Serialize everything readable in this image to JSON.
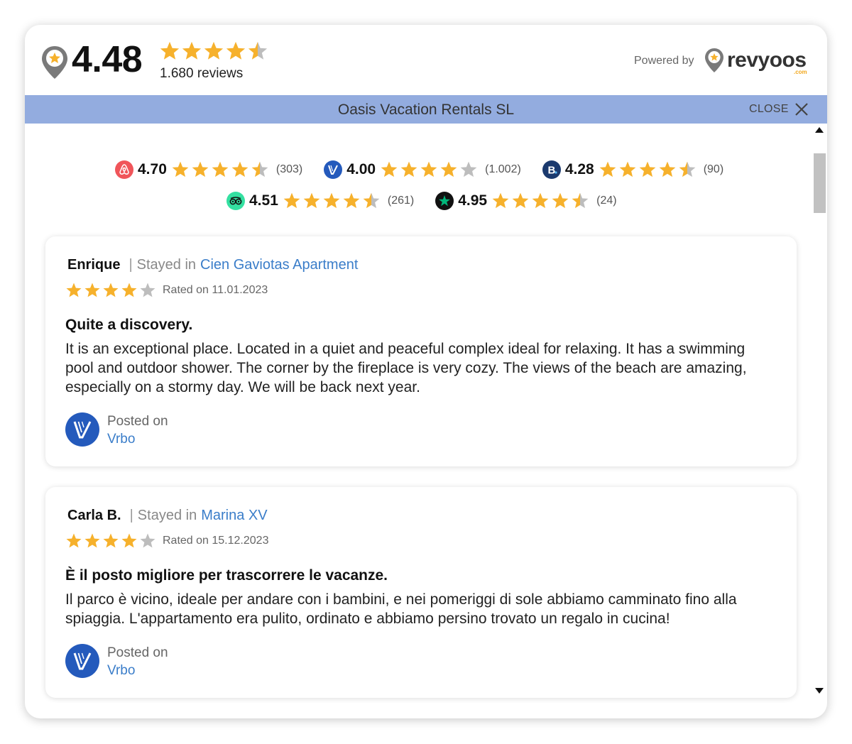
{
  "header": {
    "overall_rating": "4.48",
    "overall_stars": 4.48,
    "reviews_count": "1.680 reviews",
    "powered_by": "Powered by",
    "brand": "revyoos",
    "brand_suffix": ".com"
  },
  "titlebar": {
    "company": "Oasis Vacation Rentals SL",
    "close_label": "CLOSE"
  },
  "platforms": [
    {
      "icon": "airbnb-icon",
      "rating": "4.70",
      "count": "(303)",
      "color": "#f0555a"
    },
    {
      "icon": "vrbo-icon",
      "rating": "4.00",
      "count": "(1.002)",
      "color": "#245abc"
    },
    {
      "icon": "booking-icon",
      "rating": "4.28",
      "count": "(90)",
      "color": "#1b3a6e"
    },
    {
      "icon": "tripadvisor-icon",
      "rating": "4.51",
      "count": "(261)",
      "color": "#34e0a1"
    },
    {
      "icon": "trustpilot-icon",
      "rating": "4.95",
      "count": "(24)",
      "color": "#111111"
    }
  ],
  "reviews": [
    {
      "name": "Enrique",
      "stayed_prefix": "Stayed in",
      "property": "Cien Gaviotas Apartment",
      "stars": 4,
      "rated": "Rated on 11.01.2023",
      "title": "Quite a discovery.",
      "body": "It is an exceptional place. Located in a quiet and peaceful complex ideal for relaxing. It has a swimming pool and outdoor shower. The corner by the fireplace is very cozy. The views of the beach are amazing, especially on a stormy day. We will be back next year.",
      "posted_label": "Posted on",
      "platform": "Vrbo"
    },
    {
      "name": "Carla B.",
      "stayed_prefix": "Stayed in",
      "property": "Marina XV",
      "stars": 4,
      "rated": "Rated on 15.12.2023",
      "title": "È il posto migliore per trascorrere le vacanze.",
      "body": "Il parco è vicino, ideale per andare con i bambini, e nei pomeriggi di sole abbiamo camminato fino alla spiaggia. L'appartamento era pulito, ordinato e abbiamo persino trovato un regalo in cucina!",
      "posted_label": "Posted on",
      "platform": "Vrbo"
    }
  ],
  "colors": {
    "star_filled": "#f6b12c",
    "star_empty": "#bdbdbd",
    "titlebar_bg": "#93acdf",
    "link": "#3a7dc9"
  }
}
